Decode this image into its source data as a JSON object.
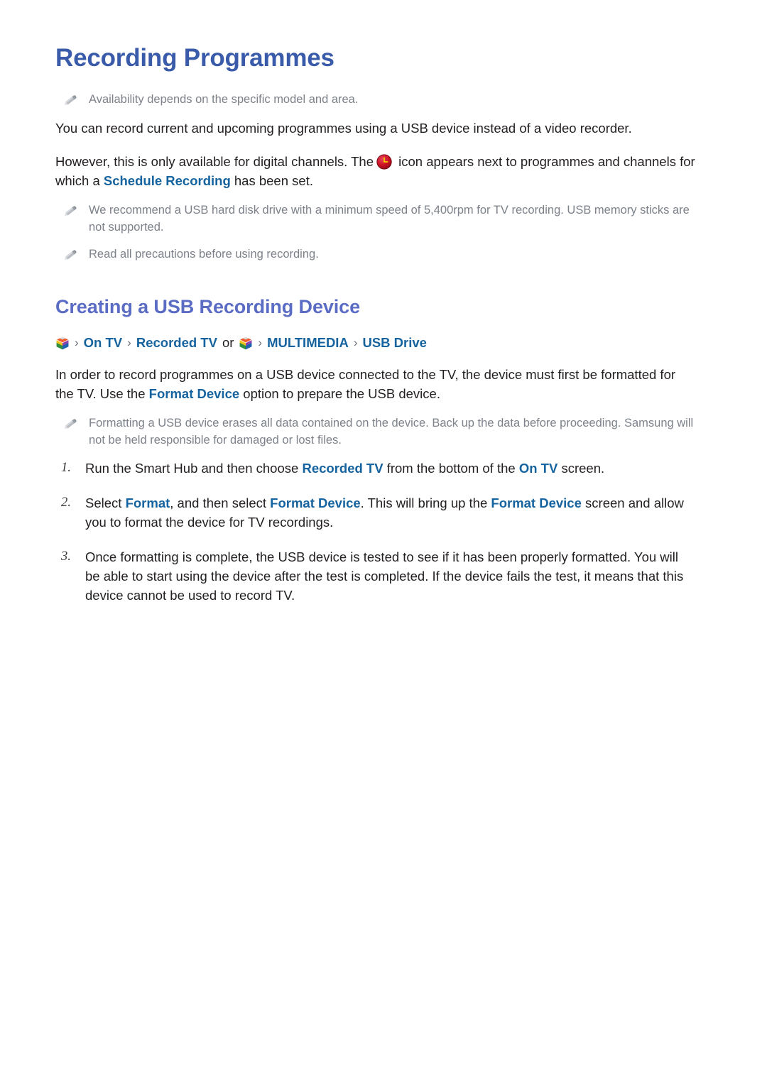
{
  "document": {
    "title": "Recording Programmes",
    "intro_note": "Availability depends on the specific model and area.",
    "paragraph_1": "You can record current and upcoming programmes using a USB device instead of a video recorder.",
    "paragraph_2_part1": "However, this is only available for digital channels. The",
    "paragraph_2_part2": "icon appears next to programmes and channels for which a",
    "paragraph_2_link": "Schedule Recording",
    "paragraph_2_part3": "has been set.",
    "note_usb_speed": "We recommend a USB hard disk drive with a minimum speed of 5,400rpm for TV recording. USB memory sticks are not supported.",
    "note_precautions": "Read all precautions before using recording."
  },
  "section": {
    "title": "Creating a USB Recording Device",
    "breadcrumb": {
      "hub_icon_1": "smart-hub-icon",
      "sep_1": "›",
      "crumb_1": "On TV",
      "sep_2": "›",
      "crumb_2": "Recorded TV",
      "or_label": "or",
      "hub_icon_2": "smart-hub-icon",
      "sep_3": "›",
      "crumb_3": "MULTIMEDIA",
      "sep_4": "›",
      "crumb_4": "USB Drive"
    },
    "paragraph_1_part1": "In order to record programmes on a USB device connected to the TV, the device must first be formatted for the TV. Use the",
    "paragraph_1_link": "Format Device",
    "paragraph_1_part2": "option to prepare the USB device.",
    "note_formatting": "Formatting a USB device erases all data contained on the device. Back up the data before proceeding. Samsung will not be held responsible for damaged or lost files."
  },
  "steps": [
    {
      "number": "1.",
      "part1": "Run the Smart Hub and then choose",
      "link1": "Recorded TV",
      "part2": "from the bottom of the",
      "link2": "On TV",
      "part3": "screen."
    },
    {
      "number": "2.",
      "part1": "Select",
      "link1": "Format",
      "part2": ", and then select",
      "link2": "Format Device",
      "part3": ". This will bring up the",
      "link3": "Format Device",
      "part4": "screen and allow you to format the device for TV recordings."
    },
    {
      "number": "3.",
      "part1": "Once formatting is complete, the USB device is tested to see if it has been properly formatted. You will be able to start using the device after the test is completed. If the device fails the test, it means that this device cannot be used to record TV."
    }
  ],
  "colors": {
    "title": "#3a5ba9",
    "section_title": "#5b6cc4",
    "link": "#15639f",
    "note_text": "#7c818a",
    "body_text": "#231f20",
    "clock_icon": "#cc1122",
    "clock_hands": "#f2c200"
  }
}
